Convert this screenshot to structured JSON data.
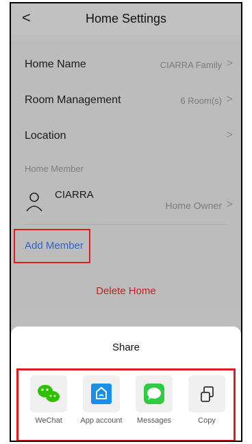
{
  "header": {
    "title": "Home Settings",
    "back_glyph": "<"
  },
  "settings": {
    "home_name": {
      "label": "Home Name",
      "value": "CIARRA Family"
    },
    "room_management": {
      "label": "Room Management",
      "value": "6 Room(s)"
    },
    "location": {
      "label": "Location",
      "value": ""
    },
    "chevron": ">"
  },
  "members": {
    "section_title": "Home Member",
    "items": [
      {
        "name": "CIARRA",
        "role": "Home Owner"
      }
    ],
    "add_label": "Add Member"
  },
  "delete_label": "Delete Home",
  "share": {
    "title": "Share",
    "items": [
      {
        "label": "WeChat",
        "icon": "wechat-icon",
        "color": "#2dc100"
      },
      {
        "label": "App account",
        "icon": "app-account-icon",
        "color": "#1a8fe8"
      },
      {
        "label": "Messages",
        "icon": "messages-icon",
        "color": "#2ecc40"
      },
      {
        "label": "Copy",
        "icon": "copy-icon",
        "color": "#333333"
      }
    ]
  },
  "colors": {
    "highlight": "#e01b1b",
    "link": "#2d63c8",
    "danger": "#c42020"
  }
}
